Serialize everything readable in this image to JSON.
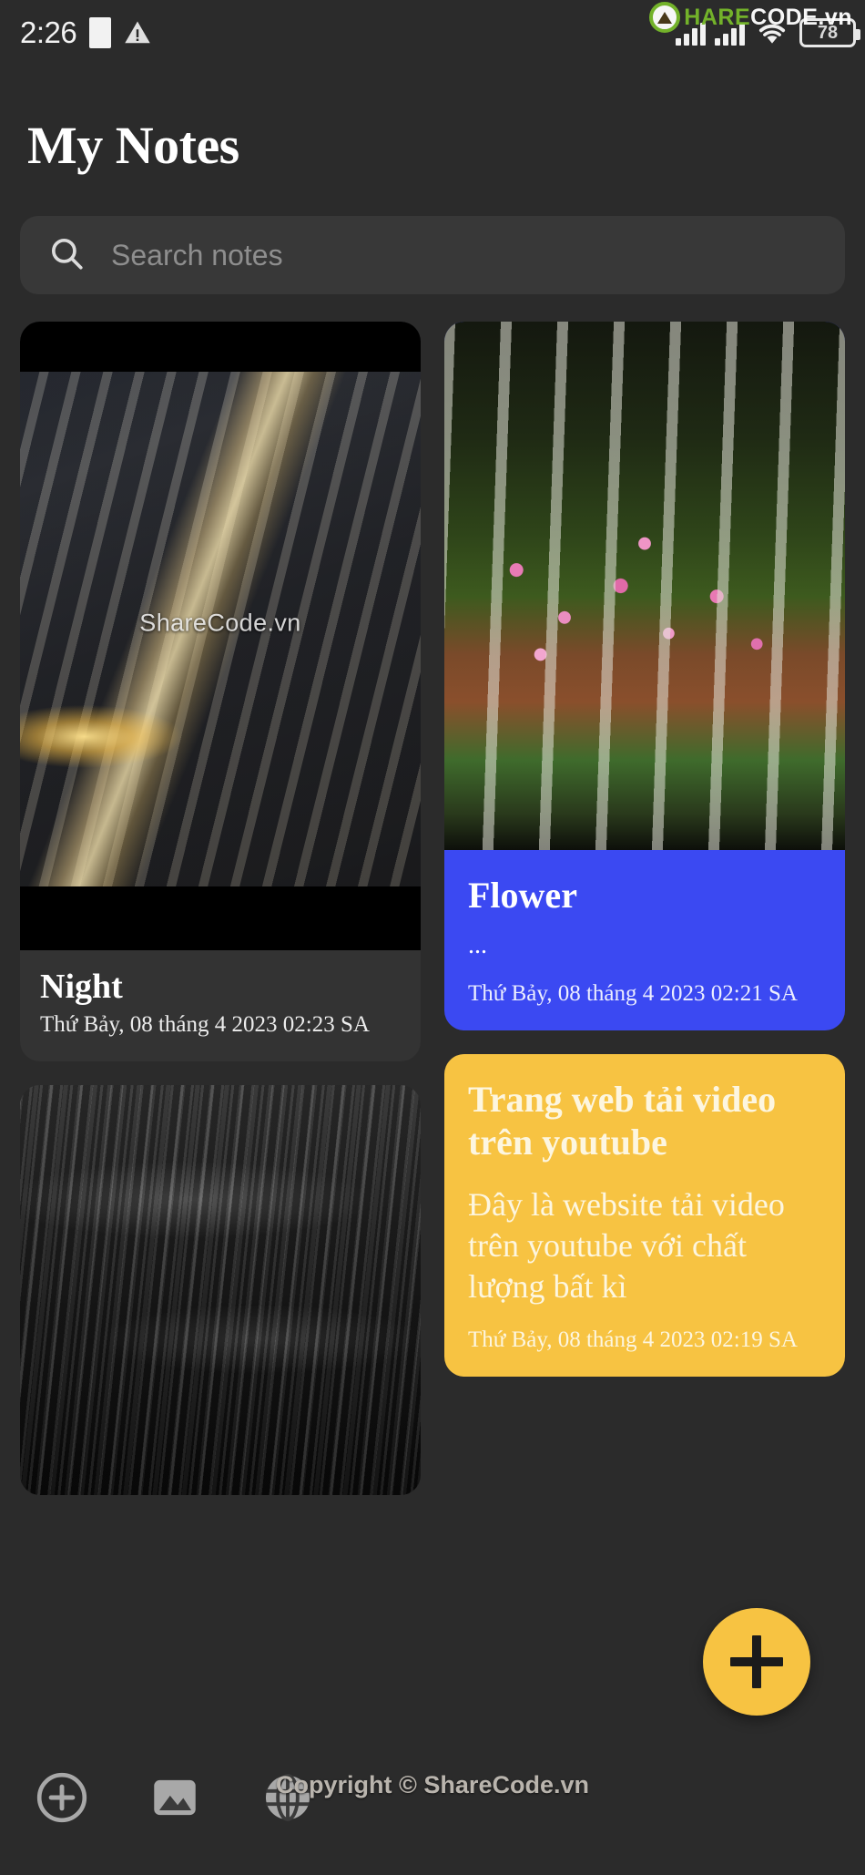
{
  "status_bar": {
    "clock": "2:26",
    "battery_level": "78",
    "icons": [
      "warning-icon",
      "signal-icon",
      "signal-icon",
      "wifi-icon",
      "battery-icon"
    ],
    "watermark": {
      "part_green_1": "S",
      "brand_green": "HARE",
      "brand_white": "CODE",
      "suffix": ".vn"
    }
  },
  "header": {
    "title": "My Notes"
  },
  "search": {
    "value": "",
    "placeholder": "Search notes"
  },
  "notes": [
    {
      "id": "night",
      "type": "photo",
      "title": "Night",
      "body": "",
      "date": "Thứ Bảy, 08 tháng 4 2023 02:23 SA",
      "image_watermark": "ShareCode.vn",
      "bg_color": "#333333",
      "text_color": "#ffffff"
    },
    {
      "id": "flower",
      "type": "photo-color",
      "title": "Flower",
      "body": "...",
      "date": "Thứ Bảy, 08 tháng 4 2023 02:21 SA",
      "bg_color": "#3b49f2",
      "text_color": "#ffffff"
    },
    {
      "id": "waves",
      "type": "photo",
      "title": "",
      "body": "",
      "date": "",
      "bg_color": "#1a1a1a",
      "text_color": "#ffffff"
    },
    {
      "id": "trang-web",
      "type": "color",
      "title": "Trang web tải video trên youtube",
      "body": "Đây là website tải video trên youtube với chất lượng bất kì",
      "date": "Thứ Bảy, 08 tháng 4 2023 02:19 SA",
      "bg_color": "#f7c342",
      "text_color": "#fdf6e0"
    }
  ],
  "fab": {
    "label": "+",
    "color": "#f7c342",
    "name": "add-note"
  },
  "bottom_nav": {
    "items": [
      {
        "name": "add-circle-icon",
        "label": "Add"
      },
      {
        "name": "image-icon",
        "label": "Images"
      },
      {
        "name": "globe-icon",
        "label": "Web"
      }
    ]
  },
  "footer": {
    "copyright": "Copyright © ShareCode.vn"
  }
}
